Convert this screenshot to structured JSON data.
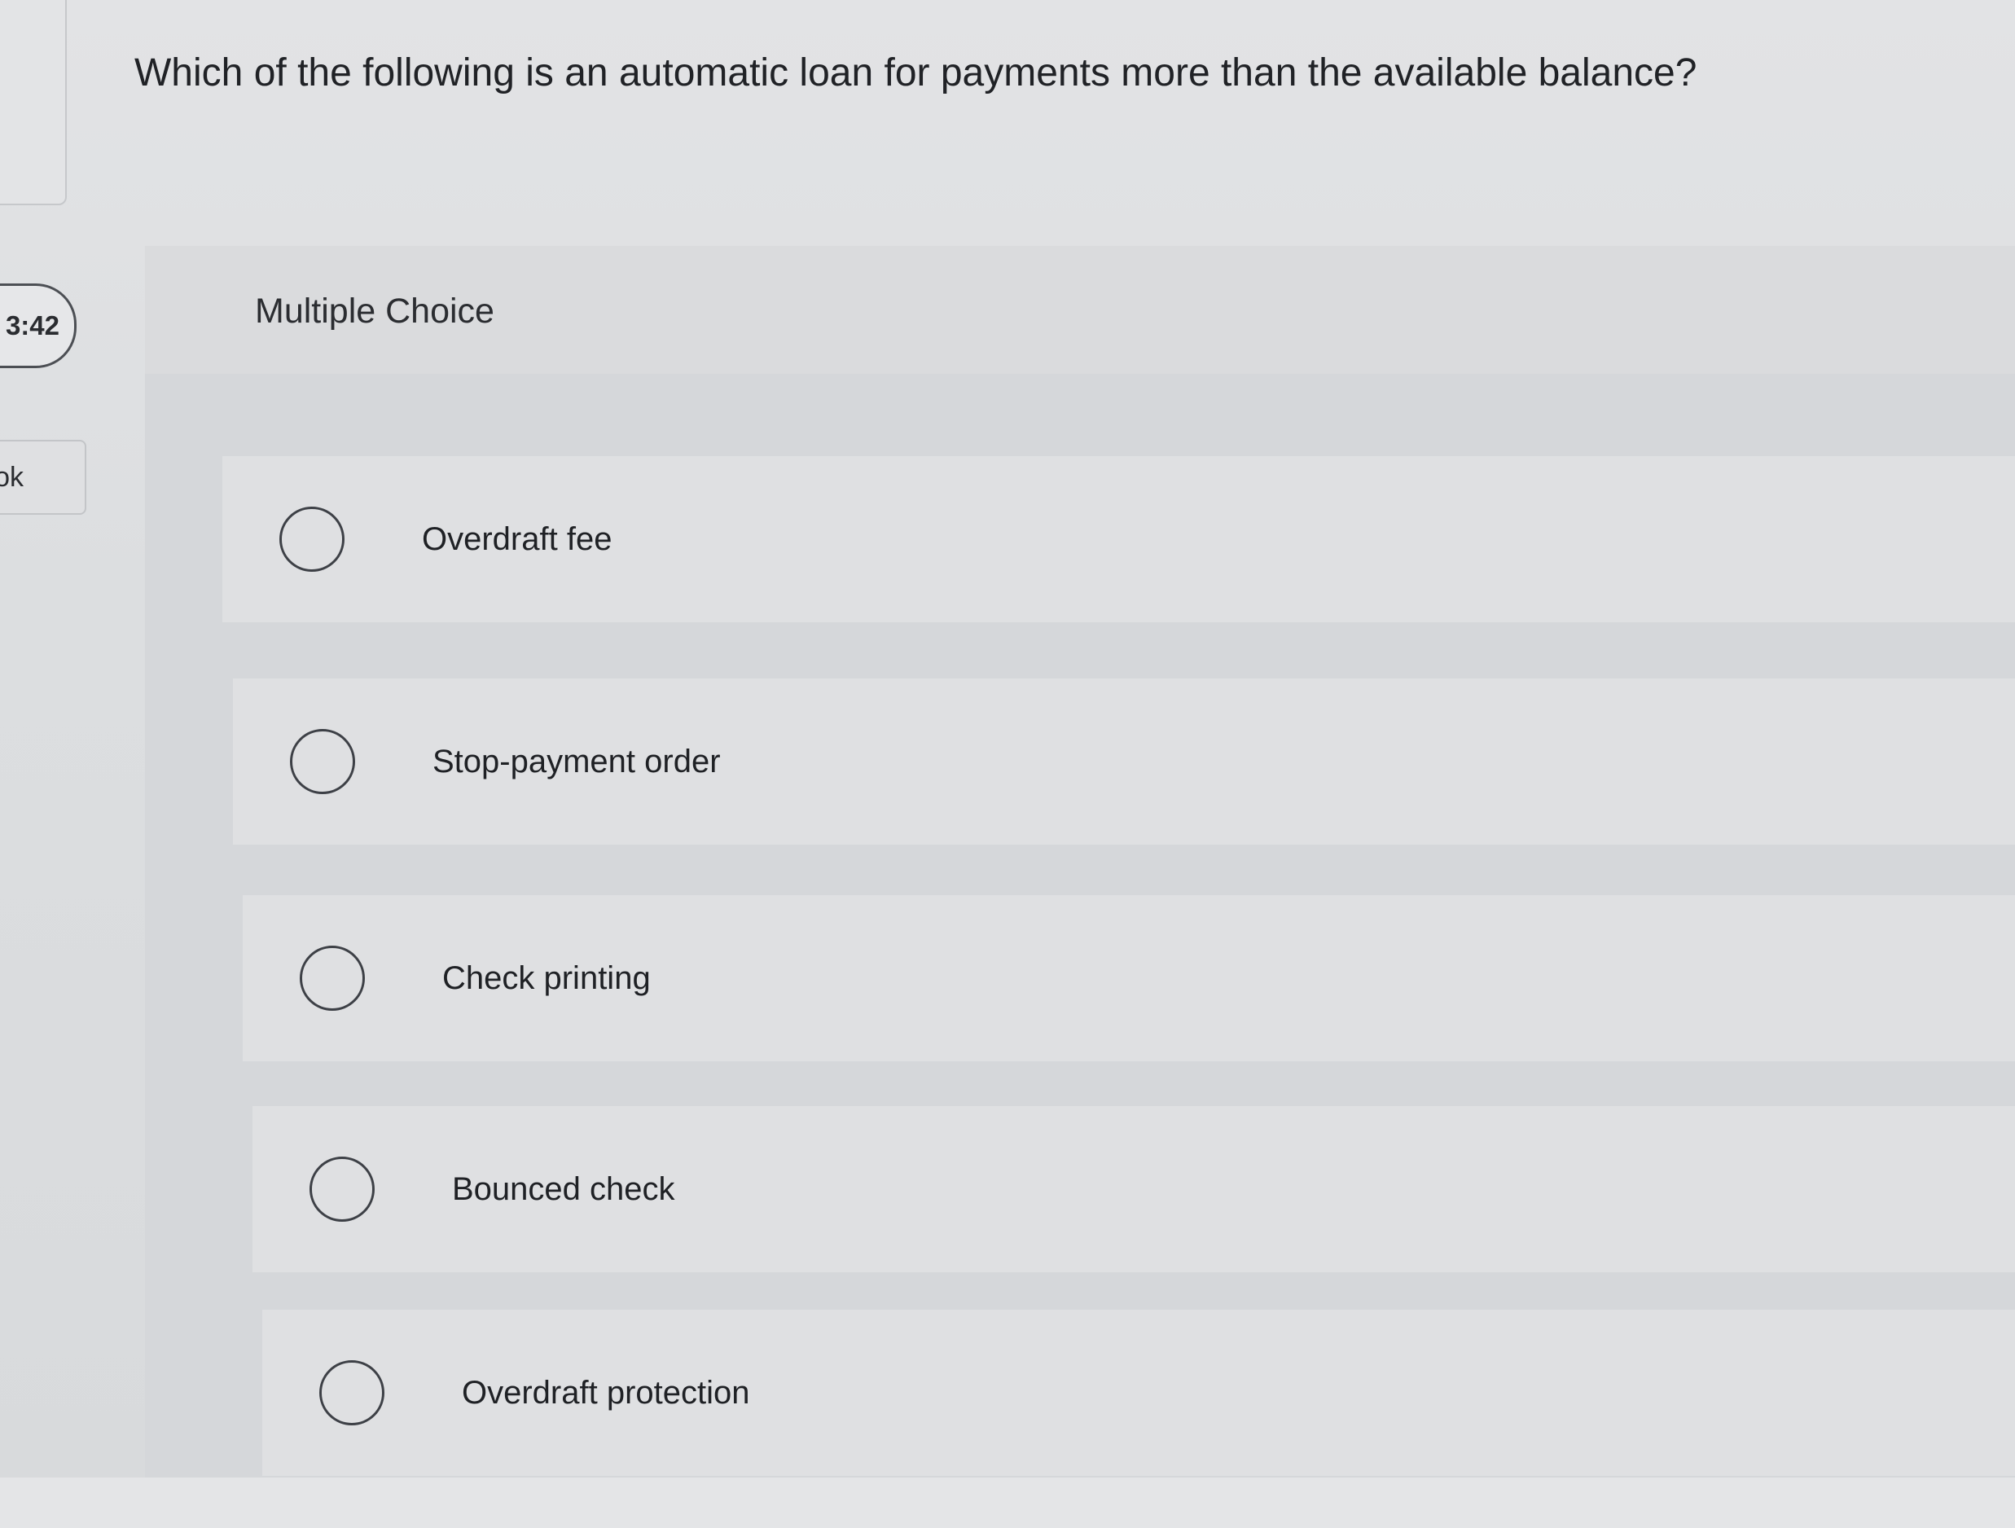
{
  "sidebar": {
    "timer": "3:42",
    "book_tab": "ok"
  },
  "question": {
    "text": "Which of the following is an automatic loan for payments more than the available balance?"
  },
  "card": {
    "type_label": "Multiple Choice",
    "options": [
      {
        "label": "Overdraft fee",
        "selected": false
      },
      {
        "label": "Stop-payment order",
        "selected": false
      },
      {
        "label": "Check printing",
        "selected": false
      },
      {
        "label": "Bounced check",
        "selected": false
      },
      {
        "label": "Overdraft protection",
        "selected": false
      }
    ]
  }
}
